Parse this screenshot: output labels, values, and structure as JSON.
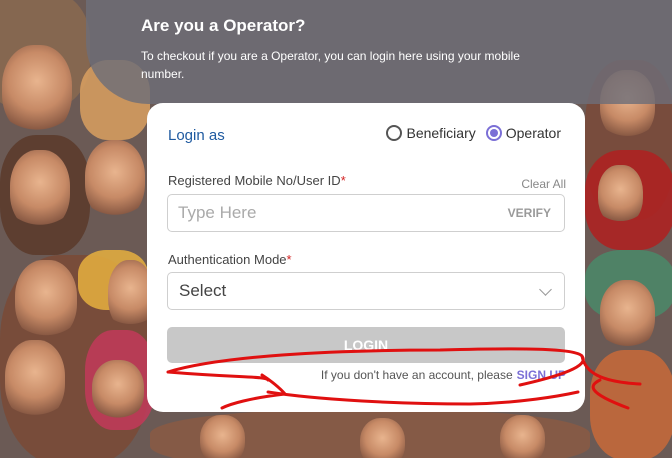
{
  "header": {
    "title": "Are you a Operator?",
    "subtitle": "To checkout if you are a Operator, you can login here using your mobile number."
  },
  "login_form": {
    "login_as_label": "Login as",
    "roles": [
      {
        "label": "Beneficiary",
        "selected": false
      },
      {
        "label": "Operator",
        "selected": true
      }
    ],
    "mobile_field": {
      "label": "Registered Mobile No/User ID",
      "required_mark": "*",
      "placeholder": "Type Here",
      "value": "",
      "clear_label": "Clear All",
      "verify_label": "VERIFY"
    },
    "auth_field": {
      "label": "Authentication Mode",
      "required_mark": "*",
      "selected_value": "Select"
    },
    "login_button_label": "LOGIN",
    "signup_prompt": "If you don't have an account, please",
    "signup_link_label": "SIGN UP"
  },
  "colors": {
    "accent": "#7b6fd6",
    "title_blue": "#1f5aa0",
    "required": "#d32222",
    "disabled_button": "#c8c8c8",
    "annotation_red": "#e01010"
  },
  "icons": [
    "radio-unchecked-icon",
    "radio-checked-icon",
    "chevron-down-icon"
  ]
}
